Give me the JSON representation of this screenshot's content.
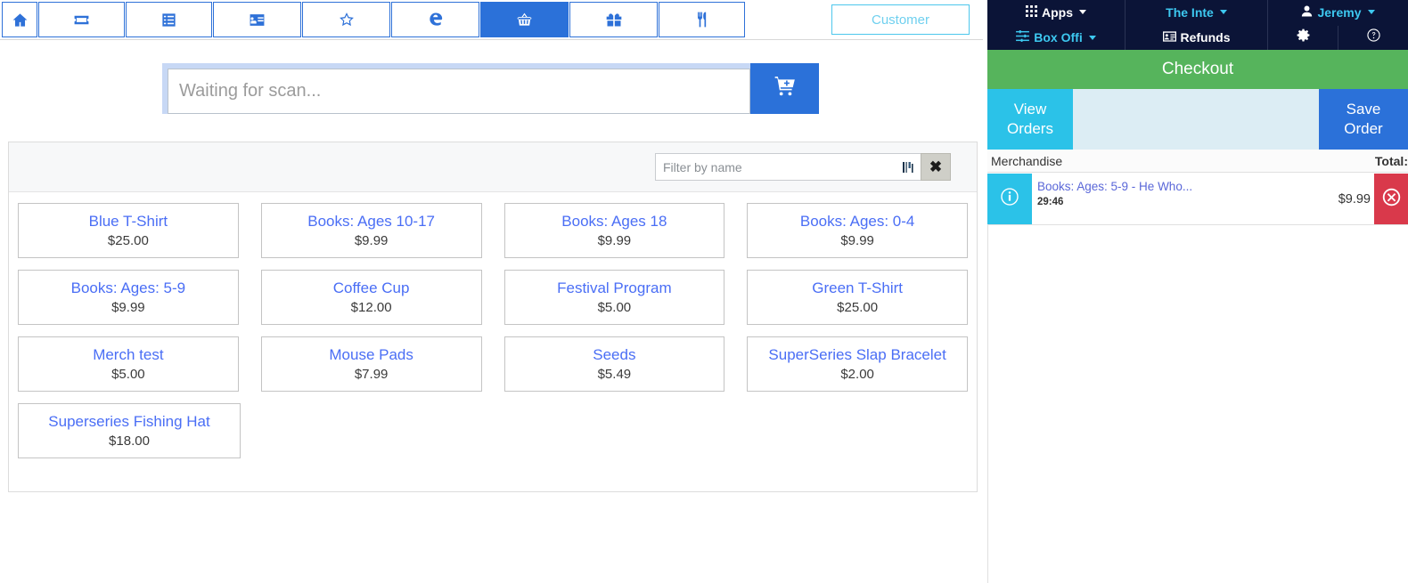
{
  "toolbar": {
    "tabs": [
      {
        "icon": "home-icon",
        "name": "tab-home",
        "active": false
      },
      {
        "icon": "ticket-icon",
        "name": "tab-tickets",
        "active": false
      },
      {
        "icon": "list-icon",
        "name": "tab-orders",
        "active": false
      },
      {
        "icon": "id-card-icon",
        "name": "tab-members",
        "active": false
      },
      {
        "icon": "star-icon",
        "name": "tab-favorites",
        "active": false
      },
      {
        "icon": "edge-icon",
        "name": "tab-exchange",
        "active": false
      },
      {
        "icon": "basket-icon",
        "name": "tab-merchandise",
        "active": true
      },
      {
        "icon": "gift-icon",
        "name": "tab-gift-cards",
        "active": false
      },
      {
        "icon": "utensils-icon",
        "name": "tab-concessions",
        "active": false
      }
    ],
    "customer_label": "Customer"
  },
  "scan": {
    "placeholder": "Waiting for scan...",
    "value": "",
    "add_button_icon": "cart-plus-icon"
  },
  "products": {
    "filter": {
      "placeholder": "Filter by name",
      "value": "",
      "barcode_icon": "barcode-icon",
      "clear_label": "✖"
    },
    "tiles": [
      {
        "name": "Blue T-Shirt",
        "price": "$25.00"
      },
      {
        "name": "Books: Ages 10-17",
        "price": "$9.99"
      },
      {
        "name": "Books: Ages 18",
        "price": "$9.99"
      },
      {
        "name": "Books: Ages: 0-4",
        "price": "$9.99"
      },
      {
        "name": "Books: Ages: 5-9",
        "price": "$9.99"
      },
      {
        "name": "Coffee Cup",
        "price": "$12.00"
      },
      {
        "name": "Festival Program",
        "price": "$5.00"
      },
      {
        "name": "Green T-Shirt",
        "price": "$25.00"
      },
      {
        "name": "Merch test",
        "price": "$5.00"
      },
      {
        "name": "Mouse Pads",
        "price": "$7.99"
      },
      {
        "name": "Seeds",
        "price": "$5.49"
      },
      {
        "name": "SuperSeries Slap Bracelet",
        "price": "$2.00"
      },
      {
        "name": "Superseries Fishing Hat",
        "price": "$18.00"
      }
    ]
  },
  "navbar": {
    "apps_label": "Apps",
    "apps_icon": "grid-icon",
    "box_office_label": "Box Offi",
    "box_office_icon": "sliders-icon",
    "org_label": "The Inte",
    "refunds_label": "Refunds",
    "refunds_icon": "id-card-icon",
    "user_label": "Jeremy",
    "user_icon": "user-icon",
    "settings_icon": "gear-icon",
    "help_icon": "question-circle-icon"
  },
  "cart": {
    "checkout_label": "Checkout",
    "view_orders_line1": "View",
    "view_orders_line2": "Orders",
    "save_order_line1": "Save",
    "save_order_line2": "Order",
    "column_item": "Merchandise",
    "column_total": "Total:",
    "items": [
      {
        "info_icon": "info-circle-icon",
        "title": "Books: Ages: 5-9 - He Who...",
        "timer": "29:46",
        "price": "$9.99",
        "delete_icon": "times-circle-icon"
      }
    ]
  },
  "colors": {
    "primary_blue": "#2b71d9",
    "cyan": "#2bc2e8",
    "green": "#56b45c",
    "red": "#d9394b",
    "navy": "#0b1437",
    "link_blue": "#4a6ef5",
    "panel_blue": "#dcedf4"
  }
}
